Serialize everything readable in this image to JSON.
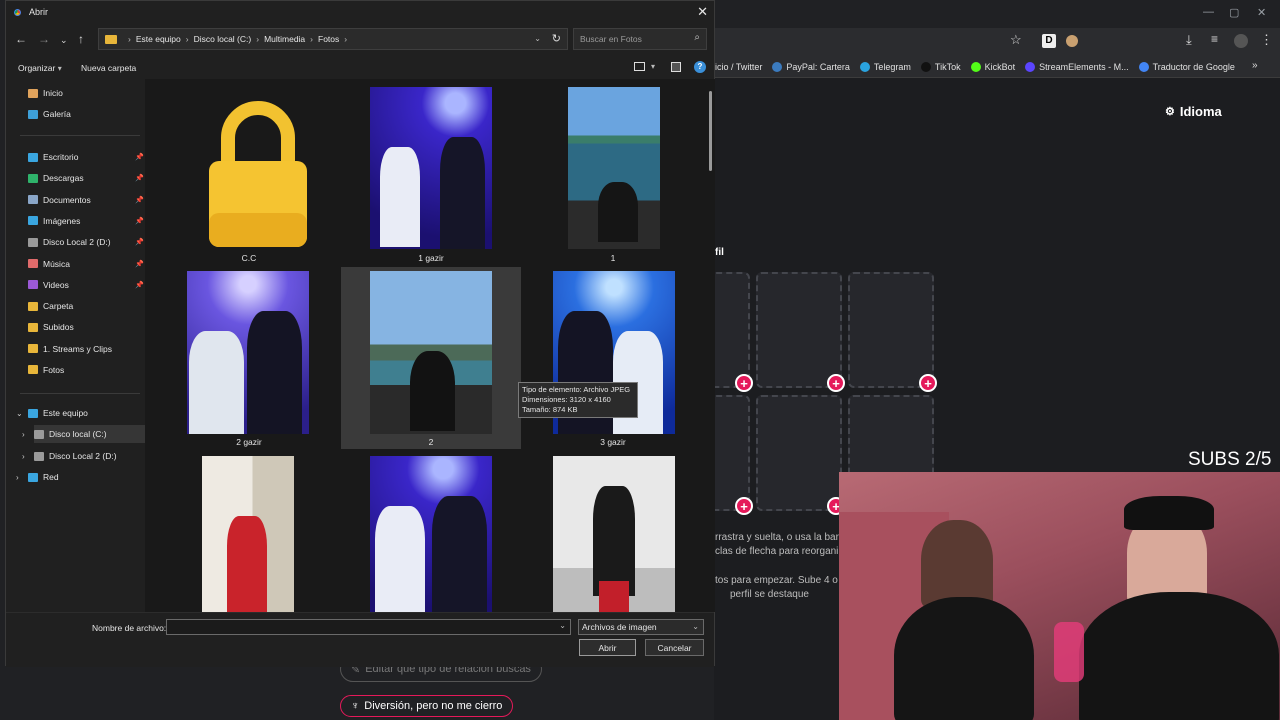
{
  "browser": {
    "bookmarks": [
      {
        "label": "nicio / Twitter",
        "color": "#1da1f2"
      },
      {
        "label": "PayPal: Cartera",
        "color": "#3b7bbf"
      },
      {
        "label": "Telegram",
        "color": "#2aa3df"
      },
      {
        "label": "TikTok",
        "color": "#111111"
      },
      {
        "label": "KickBot",
        "color": "#53fc18"
      },
      {
        "label": "StreamElements - M...",
        "color": "#5b45ff"
      },
      {
        "label": "Traductor de Google",
        "color": "#4285f4"
      }
    ],
    "page": {
      "idioma": "Idioma",
      "section_fragment": "fil",
      "text1": "rrastra y suelta, o usa la barr",
      "text2": "clas de flecha para reorgani",
      "text3": "tos para empezar. Sube 4 o",
      "text4": "perfil se destaque",
      "edit_pill": "Editar qué tipo de relación buscas",
      "fun_pill": "Diversión, pero no me cierro"
    },
    "overlay_subs": "SUBS 2/5"
  },
  "dialog": {
    "title": "Abrir",
    "breadcrumb": [
      "Este equipo",
      "Disco local (C:)",
      "Multimedia",
      "Fotos"
    ],
    "search_placeholder": "Buscar en Fotos",
    "toolbar": {
      "organize": "Organizar",
      "new_folder": "Nueva carpeta"
    },
    "sidebar": {
      "quick": [
        {
          "label": "Inicio",
          "icon": "home-icon",
          "color": "#e0a35c"
        },
        {
          "label": "Galería",
          "icon": "gallery-icon",
          "color": "#3ea0d8"
        }
      ],
      "pinned": [
        {
          "label": "Escritorio",
          "icon": "desktop-icon",
          "color": "#3aa6e0"
        },
        {
          "label": "Descargas",
          "icon": "download-icon",
          "color": "#2fb36b"
        },
        {
          "label": "Documentos",
          "icon": "documents-icon",
          "color": "#8aa6c8"
        },
        {
          "label": "Imágenes",
          "icon": "images-icon",
          "color": "#3aa6e0"
        },
        {
          "label": "Disco Local 2 (D:)",
          "icon": "drive-icon",
          "color": "#9a9a9a"
        },
        {
          "label": "Música",
          "icon": "music-icon",
          "color": "#e06b6b"
        },
        {
          "label": "Videos",
          "icon": "videos-icon",
          "color": "#9b59d6"
        }
      ],
      "folders": [
        {
          "label": "Carpeta",
          "icon": "folder-icon",
          "color": "#e8b63a"
        },
        {
          "label": "Subidos",
          "icon": "folder-icon",
          "color": "#e8b63a"
        },
        {
          "label": "1. Streams y Clips",
          "icon": "folder-icon",
          "color": "#e8b63a"
        },
        {
          "label": "Fotos",
          "icon": "folder-icon",
          "color": "#e8b63a"
        }
      ],
      "tree": [
        {
          "label": "Este equipo",
          "icon": "computer-icon",
          "color": "#3aa6e0"
        },
        {
          "label": "Disco local (C:)",
          "icon": "drive-icon",
          "color": "#9a9a9a"
        },
        {
          "label": "Disco Local 2 (D:)",
          "icon": "drive-icon",
          "color": "#9a9a9a"
        },
        {
          "label": "Red",
          "icon": "network-icon",
          "color": "#3aa6e0"
        }
      ]
    },
    "files": [
      {
        "name": "C.C"
      },
      {
        "name": "1 gazir"
      },
      {
        "name": "1"
      },
      {
        "name": "2 gazir"
      },
      {
        "name": "2"
      },
      {
        "name": "3 gazir"
      }
    ],
    "tooltip": {
      "type": "Tipo de elemento: Archivo JPEG",
      "dims": "Dimensiones: 3120 x 4160",
      "size": "Tamaño: 874 KB"
    },
    "bottom": {
      "filename_label": "Nombre de archivo:",
      "filename_value": "",
      "filter": "Archivos de imagen",
      "open": "Abrir",
      "cancel": "Cancelar"
    }
  }
}
